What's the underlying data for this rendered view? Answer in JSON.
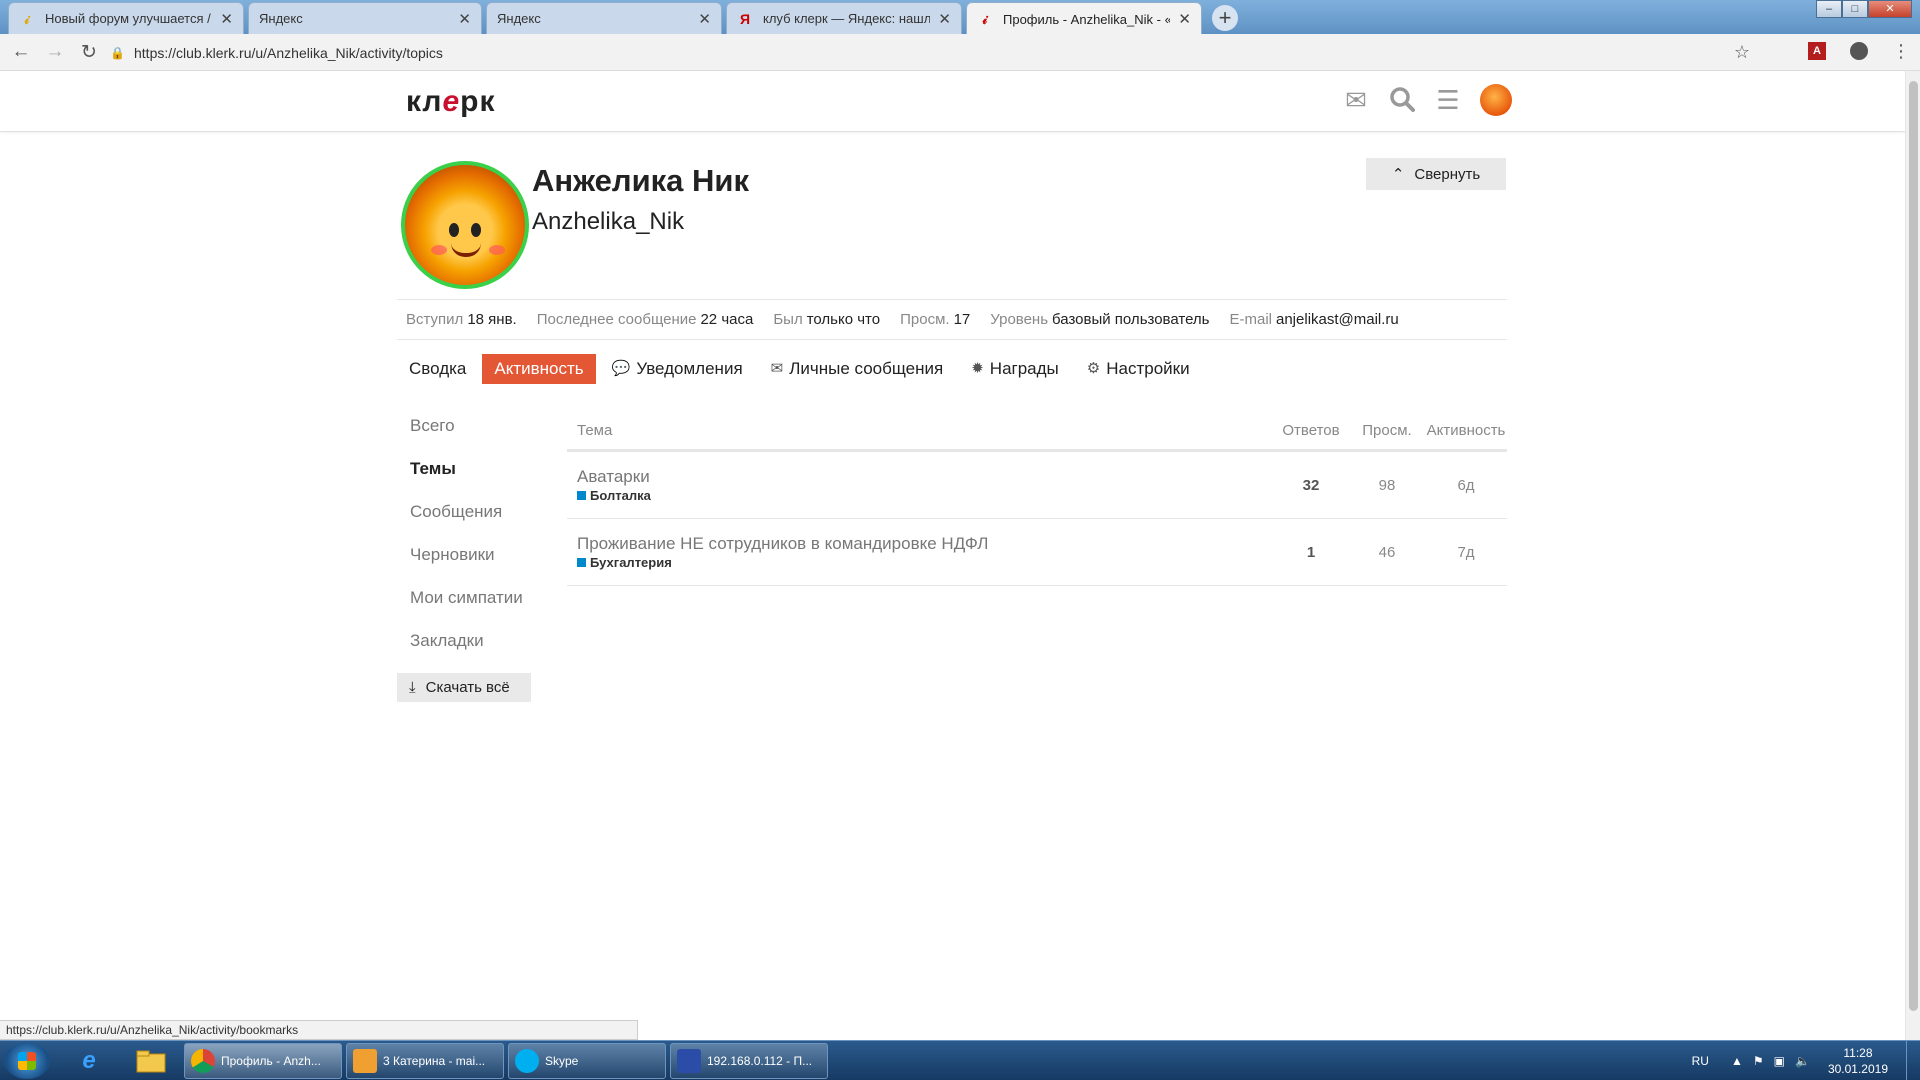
{
  "browser": {
    "tabs": [
      {
        "title": "Новый форум улучшается / Ещё",
        "favicon": "klerk-icon"
      },
      {
        "title": "Яндекс",
        "favicon": "blank"
      },
      {
        "title": "Яндекс",
        "favicon": "blank"
      },
      {
        "title": "клуб клерк — Яндекс: нашлось",
        "favicon": "yandex-icon"
      },
      {
        "title": "Профиль - Anzhelika_Nik - «Кле",
        "favicon": "klerk-icon"
      }
    ],
    "new_tab": "+",
    "url": "https://club.klerk.ru/u/Anzhelika_Nik/activity/topics",
    "window_controls": {
      "minimize": "–",
      "maximize": "□",
      "close": "✕"
    },
    "status_url": "https://club.klerk.ru/u/Anzhelika_Nik/activity/bookmarks"
  },
  "site": {
    "logo_left": "кл",
    "logo_mid": "е",
    "logo_right": "рк",
    "accent_color": "#e45735"
  },
  "profile": {
    "full_name": "Анжелика Ник",
    "username": "Anzhelika_Nik",
    "collapse_label": "Свернуть",
    "stats": [
      {
        "key": "Вступил",
        "value": "18 янв."
      },
      {
        "key": "Последнее сообщение",
        "value": "22 часа"
      },
      {
        "key": "Был",
        "value": "только что"
      },
      {
        "key": "Просм.",
        "value": "17"
      },
      {
        "key": "Уровень",
        "value": "базовый пользователь"
      },
      {
        "key": "E-mail",
        "value": "anjelikast@mail.ru"
      }
    ],
    "nav": [
      {
        "label": "Сводка",
        "icon": ""
      },
      {
        "label": "Активность",
        "icon": "",
        "active": true
      },
      {
        "label": "Уведомления",
        "icon": "comment-icon"
      },
      {
        "label": "Личные сообщения",
        "icon": "envelope-icon"
      },
      {
        "label": "Награды",
        "icon": "badge-icon"
      },
      {
        "label": "Настройки",
        "icon": "gear-icon"
      }
    ]
  },
  "activity_nav": {
    "items": [
      "Всего",
      "Темы",
      "Сообщения",
      "Черновики",
      "Мои симпатии",
      "Закладки"
    ],
    "active": "Темы",
    "download_label": "Скачать всё"
  },
  "topics": {
    "headers": {
      "title": "Тема",
      "replies": "Ответов",
      "views": "Просм.",
      "activity": "Активность"
    },
    "rows": [
      {
        "title": "Аватарки",
        "category": "Болталка",
        "replies": "32",
        "views": "98",
        "activity": "6д"
      },
      {
        "title": "Проживание НЕ сотрудников в командировке НДФЛ",
        "category": "Бухгалтерия",
        "replies": "1",
        "views": "46",
        "activity": "7д"
      }
    ]
  },
  "taskbar": {
    "tasks": [
      {
        "label": "Профиль - Anzh..."
      },
      {
        "label": "3 Катерина - mai..."
      },
      {
        "label": "Skype"
      },
      {
        "label": "192.168.0.112 - П..."
      }
    ],
    "lang": "RU",
    "time": "11:28",
    "date": "30.01.2019"
  }
}
